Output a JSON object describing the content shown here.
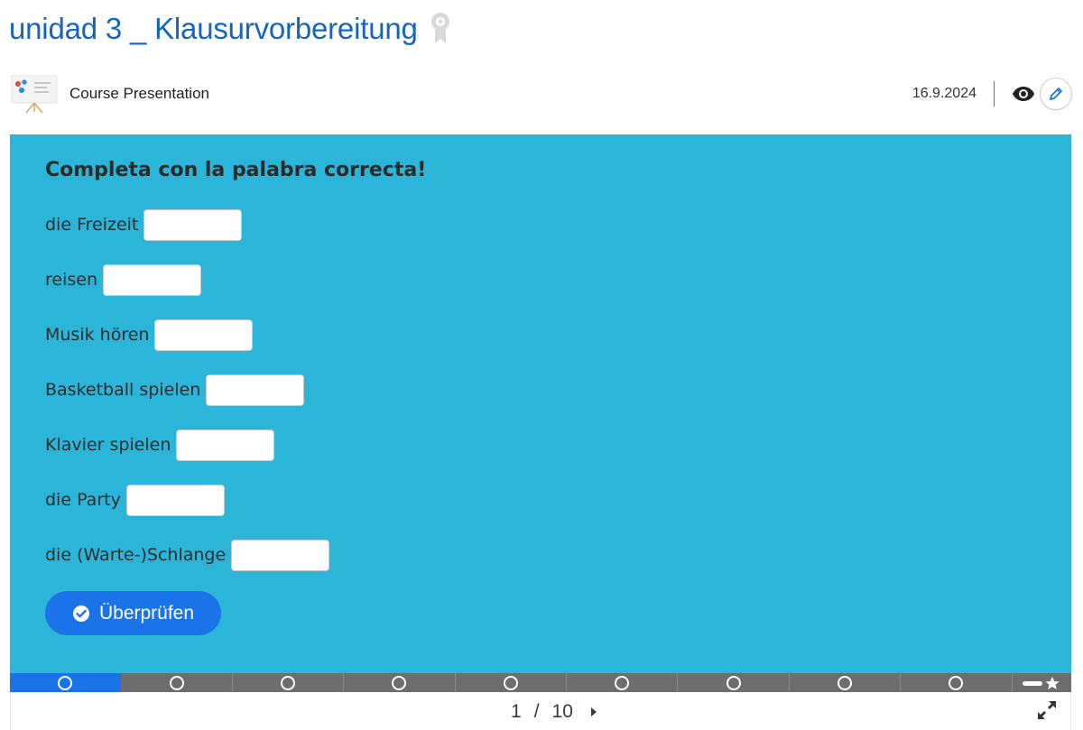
{
  "page": {
    "title": "unidad 3 _ Klausurvorbereitung"
  },
  "meta": {
    "content_type": "Course Presentation",
    "date": "16.9.2024",
    "icons": {
      "type": "presentation-icon",
      "view": "eye-icon",
      "edit": "pencil-icon",
      "badge": "award-ribbon-icon"
    }
  },
  "slide": {
    "task_title": "Completa con la palabra correcta!",
    "items": [
      {
        "word": "die Freizeit",
        "answer": ""
      },
      {
        "word": "reisen",
        "answer": ""
      },
      {
        "word": "Musik hören",
        "answer": ""
      },
      {
        "word": "Basketball spielen",
        "answer": ""
      },
      {
        "word": "Klavier spielen",
        "answer": ""
      },
      {
        "word": "die Party",
        "answer": ""
      },
      {
        "word": "die (Warte-)Schlange",
        "answer": ""
      }
    ],
    "check_label": "Überprüfen"
  },
  "navigation": {
    "current_page": "1",
    "separator": "/",
    "total_pages": "10",
    "active_slide": 1
  },
  "colors": {
    "title": "#1565c0",
    "slide_bg": "#2bb5d9",
    "button": "#1a73e8",
    "progress_bg": "#6d6d6d"
  }
}
